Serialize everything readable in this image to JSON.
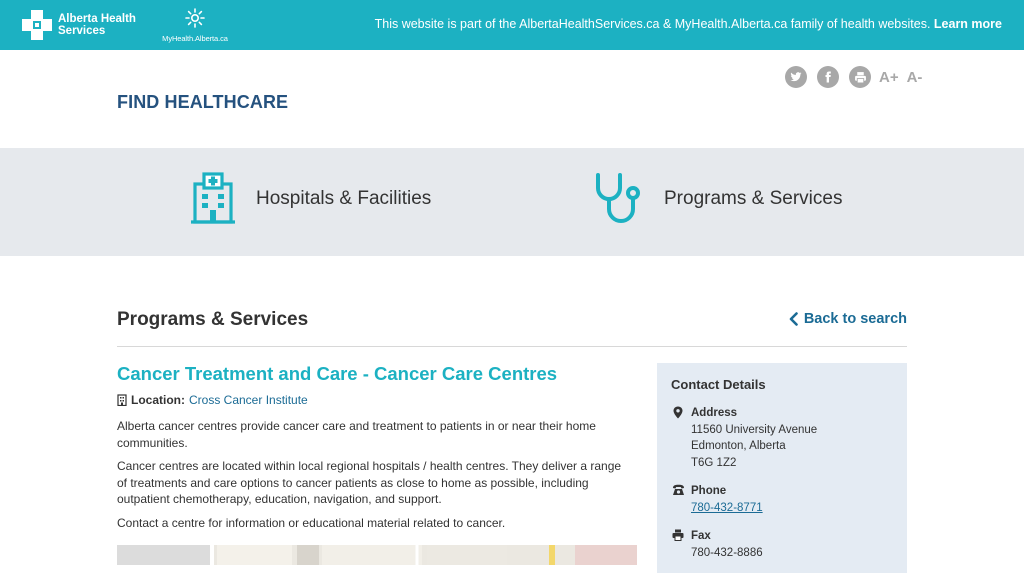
{
  "banner": {
    "ahs_logo_line1": "Alberta Health",
    "ahs_logo_line2": "Services",
    "myhealth_logo_text": "MyHealth.Alberta.ca",
    "note": "This website is part of the AlbertaHealthServices.ca & MyHealth.Alberta.ca family of health websites.",
    "learn_more": "Learn more"
  },
  "header": {
    "title": "FIND HEALTHCARE",
    "tools": {
      "twitter_icon": "twitter-icon",
      "facebook_icon": "facebook-icon",
      "print_icon": "print-icon",
      "font_increase": "A+",
      "font_decrease": "A-"
    }
  },
  "categories": [
    {
      "label": "Hospitals & Facilities",
      "icon": "hospital-building-icon"
    },
    {
      "label": "Programs & Services",
      "icon": "stethoscope-icon"
    }
  ],
  "section": {
    "title": "Programs & Services",
    "back_link": "Back to search"
  },
  "program": {
    "title": "Cancer Treatment and Care - Cancer Care Centres",
    "location_label": "Location:",
    "location_value": "Cross Cancer Institute",
    "paragraphs": [
      "Alberta cancer centres provide cancer care and treatment to patients in or near their home communities.",
      "Cancer centres are located within local regional hospitals / health centres. They deliver a range of treatments and care options to cancer patients as close to home as possible, including outpatient chemotherapy, education, navigation, and support.",
      "Contact a centre for information or educational material related to cancer."
    ]
  },
  "contact": {
    "title": "Contact Details",
    "address": {
      "label": "Address",
      "line1": "11560 University Avenue",
      "line2": "Edmonton, Alberta",
      "line3": "T6G 1Z2"
    },
    "phone": {
      "label": "Phone",
      "value": "780-432-8771"
    },
    "fax": {
      "label": "Fax",
      "value": "780-432-8886"
    }
  },
  "colors": {
    "brand_teal": "#1cb1c2",
    "heading_blue": "#25527f",
    "link_blue": "#1b6b95",
    "band_gray": "#e6e9ed",
    "contact_bg": "#e4ebf3"
  }
}
